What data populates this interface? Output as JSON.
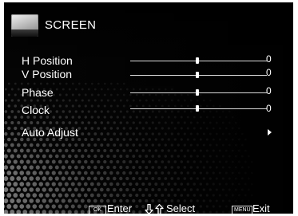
{
  "header": {
    "title": "SCREEN",
    "icon": "screen-icon"
  },
  "menu": {
    "items": [
      {
        "label": "H Position",
        "value": "0",
        "level": 0.5
      },
      {
        "label": "V Position",
        "value": "0",
        "level": 0.5
      },
      {
        "label": "Phase",
        "value": "0",
        "level": 0.5
      },
      {
        "label": "Clock",
        "value": "0",
        "level": 0.5
      }
    ],
    "auto_adjust": {
      "label": "Auto Adjust"
    }
  },
  "footer": {
    "enter_key": "OK",
    "enter_label": "Enter",
    "select_label": "Select",
    "exit_key": "MENU",
    "exit_label": "Exit"
  },
  "colors": {
    "background": "#060606",
    "text": "#ffffff",
    "track": "#dcdcdc"
  }
}
